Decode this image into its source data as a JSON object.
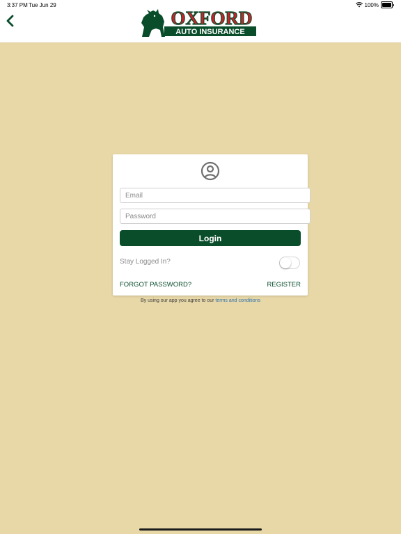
{
  "status_bar": {
    "time": "3:37 PM",
    "date": "Tue Jun 29",
    "battery_percent": "100%",
    "battery_level": 1.0
  },
  "header": {
    "back_icon": "chevron-left-icon",
    "logo": {
      "brand": "OXFORD",
      "tagline": "AUTO INSURANCE"
    }
  },
  "login_card": {
    "user_icon": "user-circle-icon",
    "email_placeholder": "Email",
    "email_value": "",
    "password_placeholder": "Password",
    "password_value": "",
    "login_label": "Login",
    "stay_logged_in_label": "Stay Logged In?",
    "stay_logged_in_on": false,
    "forgot_password_label": "FORGOT PASSWORD?",
    "register_label": "REGISTER"
  },
  "terms": {
    "prefix": "By using our app you agree to our",
    "link_label": "terms and conditions"
  },
  "colors": {
    "background": "#e8d8a8",
    "brand_green": "#0a4d2b",
    "brand_red": "#d0202a",
    "link_blue": "#2a6fa8"
  }
}
